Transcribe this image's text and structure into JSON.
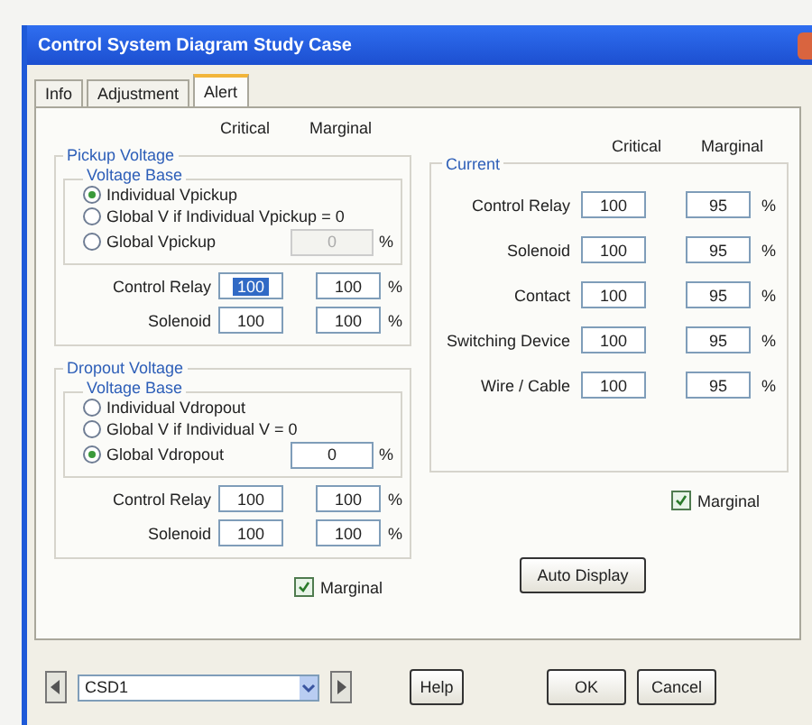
{
  "window": {
    "title": "Control System Diagram Study Case"
  },
  "tabs": [
    {
      "label": "Info",
      "selected": false
    },
    {
      "label": "Adjustment",
      "selected": false
    },
    {
      "label": "Alert",
      "selected": true
    }
  ],
  "left_headers": [
    "Critical",
    "Marginal"
  ],
  "voltage_groups": [
    {
      "title": "Pickup Voltage",
      "base_title": "Voltage Base",
      "options": [
        {
          "label": "Individual Vpickup",
          "selected": true
        },
        {
          "label": "Global V if Individual Vpickup = 0",
          "selected": false
        },
        {
          "label": "Global Vpickup",
          "selected": false
        }
      ],
      "global_value": "0",
      "global_disabled": true,
      "global_unit": "%",
      "rows": [
        {
          "label": "Control Relay",
          "critical": "100",
          "marginal": "100",
          "unit": "%",
          "focused": true
        },
        {
          "label": "Solenoid",
          "critical": "100",
          "marginal": "100",
          "unit": "%",
          "focused": false
        }
      ]
    },
    {
      "title": "Dropout Voltage",
      "base_title": "Voltage Base",
      "options": [
        {
          "label": "Individual Vdropout",
          "selected": false
        },
        {
          "label": "Global V if Individual V = 0",
          "selected": false
        },
        {
          "label": "Global Vdropout",
          "selected": true
        }
      ],
      "global_value": "0",
      "global_disabled": false,
      "global_unit": "%",
      "rows": [
        {
          "label": "Control Relay",
          "critical": "100",
          "marginal": "100",
          "unit": "%",
          "focused": false
        },
        {
          "label": "Solenoid",
          "critical": "100",
          "marginal": "100",
          "unit": "%",
          "focused": false
        }
      ]
    }
  ],
  "left_marginal": {
    "label": "Marginal",
    "checked": true
  },
  "right_headers": [
    "Critical",
    "Marginal"
  ],
  "current": {
    "title": "Current",
    "rows": [
      {
        "label": "Control Relay",
        "critical": "100",
        "marginal": "95",
        "unit": "%"
      },
      {
        "label": "Solenoid",
        "critical": "100",
        "marginal": "95",
        "unit": "%"
      },
      {
        "label": "Contact",
        "critical": "100",
        "marginal": "95",
        "unit": "%"
      },
      {
        "label": "Switching Device",
        "critical": "100",
        "marginal": "95",
        "unit": "%"
      },
      {
        "label": "Wire / Cable",
        "critical": "100",
        "marginal": "95",
        "unit": "%"
      }
    ]
  },
  "right_marginal": {
    "label": "Marginal",
    "checked": true
  },
  "auto_display": "Auto Display",
  "case_select": {
    "value": "CSD1"
  },
  "buttons": [
    "Help",
    "OK",
    "Cancel"
  ]
}
